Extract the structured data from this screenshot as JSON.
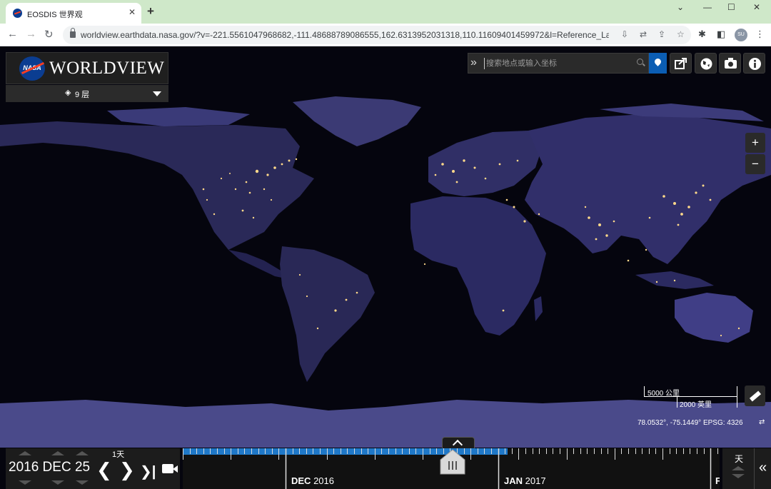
{
  "browser": {
    "tab_title": "EOSDIS 世界观",
    "tab_close": "✕",
    "new_tab": "+",
    "url": "worldview.earthdata.nasa.gov/?v=-221.5561047968682,-111.48688789086555,162.6313952031318,110.11609401459972&l=Reference_La...",
    "profile_initials": "SU",
    "colors": {
      "tabbar": "#cfe8c9",
      "omnibox": "#f1f3f4"
    }
  },
  "app": {
    "logo_text": "NASA",
    "title": "WORLDVIEW",
    "layers_label": "9 层",
    "search_placeholder": "搜索地点或输入坐标",
    "zoom_in": "+",
    "zoom_out": "−",
    "scale_km": "5000 公里",
    "scale_mi": "2000 英里",
    "coordinates": "78.0532°, -75.1449°  EPSG: 4326",
    "accent_color": "#0b5db3"
  },
  "timeline": {
    "date": "2016 DEC 25",
    "step": "1天",
    "zoom_level": "天",
    "months": [
      {
        "bold": "DEC",
        "rest": " 2016"
      },
      {
        "bold": "JAN",
        "rest": " 2017"
      },
      {
        "bold": "F",
        "rest": ""
      }
    ],
    "availability_color": "#1f78c8"
  }
}
